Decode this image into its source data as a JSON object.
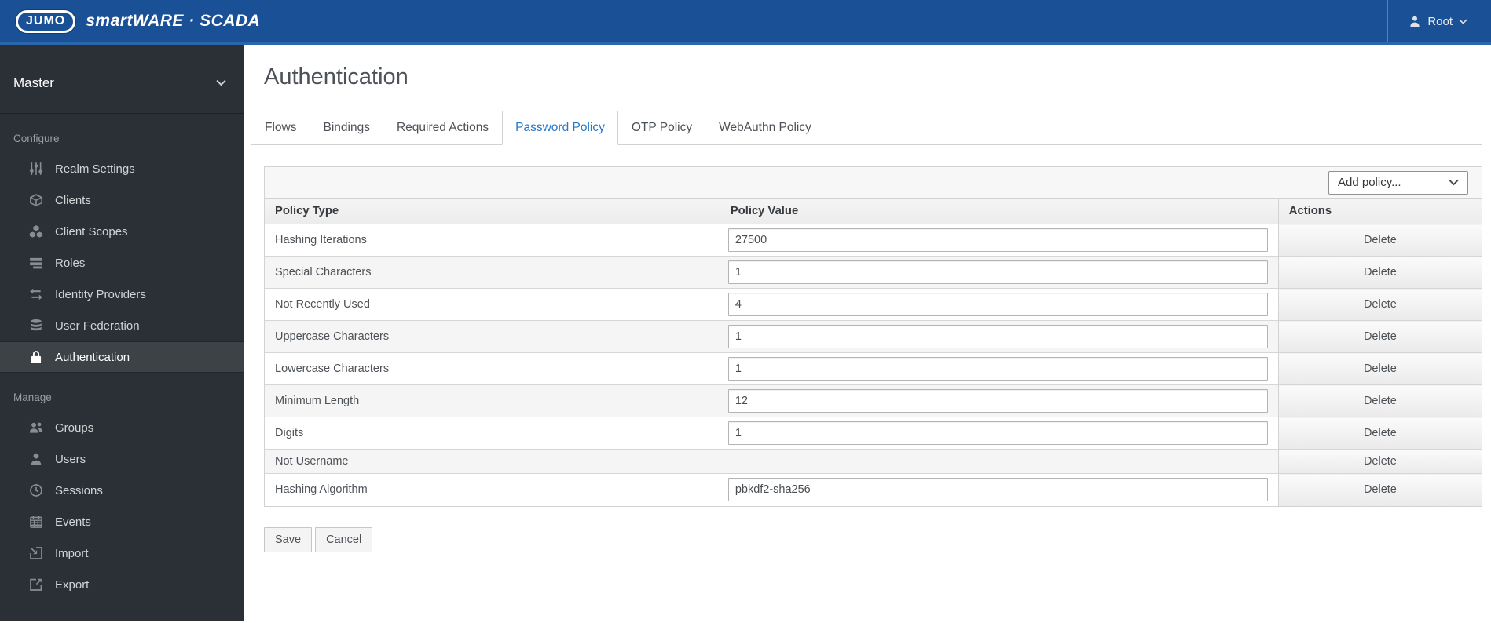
{
  "header": {
    "logo_text": "JUMO",
    "brand": "smartWARE · SCADA",
    "user_name": "Root",
    "user_icon": "user-icon",
    "user_chevron_icon": "chevron-down-icon"
  },
  "sidebar": {
    "realm": "Master",
    "realm_chevron_icon": "chevron-down-icon",
    "sections": [
      {
        "label": "Configure",
        "items": [
          {
            "label": "Realm Settings",
            "icon": "sliders-icon",
            "active": false
          },
          {
            "label": "Clients",
            "icon": "cube-icon",
            "active": false
          },
          {
            "label": "Client Scopes",
            "icon": "cubes-icon",
            "active": false
          },
          {
            "label": "Roles",
            "icon": "list-icon",
            "active": false
          },
          {
            "label": "Identity Providers",
            "icon": "exchange-icon",
            "active": false
          },
          {
            "label": "User Federation",
            "icon": "database-icon",
            "active": false
          },
          {
            "label": "Authentication",
            "icon": "lock-icon",
            "active": true
          }
        ]
      },
      {
        "label": "Manage",
        "items": [
          {
            "label": "Groups",
            "icon": "users-icon",
            "active": false
          },
          {
            "label": "Users",
            "icon": "user-icon",
            "active": false
          },
          {
            "label": "Sessions",
            "icon": "clock-icon",
            "active": false
          },
          {
            "label": "Events",
            "icon": "calendar-icon",
            "active": false
          },
          {
            "label": "Import",
            "icon": "import-icon",
            "active": false
          },
          {
            "label": "Export",
            "icon": "export-icon",
            "active": false
          }
        ]
      }
    ]
  },
  "main": {
    "title": "Authentication",
    "tabs": [
      {
        "label": "Flows",
        "active": false
      },
      {
        "label": "Bindings",
        "active": false
      },
      {
        "label": "Required Actions",
        "active": false
      },
      {
        "label": "Password Policy",
        "active": true
      },
      {
        "label": "OTP Policy",
        "active": false
      },
      {
        "label": "WebAuthn Policy",
        "active": false
      }
    ],
    "toolbar": {
      "add_policy_label": "Add policy...",
      "chevron_icon": "chevron-down-icon"
    },
    "table": {
      "columns": [
        "Policy Type",
        "Policy Value",
        "Actions"
      ],
      "column_widths_pct": [
        37.4,
        45.9,
        16.7
      ],
      "rows": [
        {
          "type": "Hashing Iterations",
          "value": "27500",
          "has_input": true,
          "action": "Delete"
        },
        {
          "type": "Special Characters",
          "value": "1",
          "has_input": true,
          "action": "Delete"
        },
        {
          "type": "Not Recently Used",
          "value": "4",
          "has_input": true,
          "action": "Delete"
        },
        {
          "type": "Uppercase Characters",
          "value": "1",
          "has_input": true,
          "action": "Delete"
        },
        {
          "type": "Lowercase Characters",
          "value": "1",
          "has_input": true,
          "action": "Delete"
        },
        {
          "type": "Minimum Length",
          "value": "12",
          "has_input": true,
          "action": "Delete"
        },
        {
          "type": "Digits",
          "value": "1",
          "has_input": true,
          "action": "Delete"
        },
        {
          "type": "Not Username",
          "value": "",
          "has_input": false,
          "action": "Delete"
        },
        {
          "type": "Hashing Algorithm",
          "value": "pbkdf2-sha256",
          "has_input": true,
          "action": "Delete"
        }
      ]
    },
    "buttons": {
      "save": "Save",
      "cancel": "Cancel"
    }
  },
  "colors": {
    "header_blue": "#1a5096",
    "header_border_blue": "#2a66ab",
    "sidebar_bg": "#2b3036",
    "sidebar_active_bg": "#3d4247",
    "active_tab_blue": "#2878c8",
    "table_border": "#d2d2d2",
    "stripe_gray": "#f5f5f5",
    "text_gray": "#4d5258"
  }
}
